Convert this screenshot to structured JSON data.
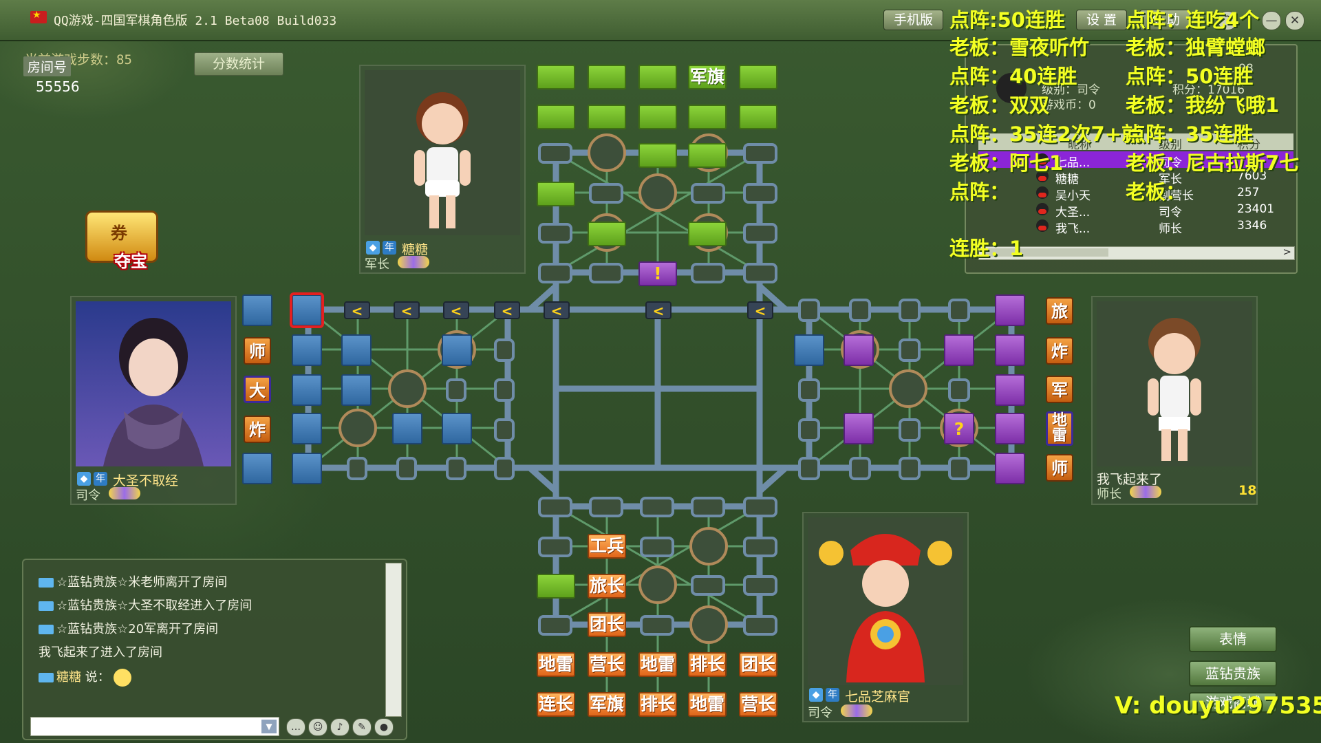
{
  "window": {
    "title": "QQ游戏-四国军棋角色版 2.1 Beta08 Build033",
    "top_buttons": [
      "手机版",
      "设 置",
      "帮 助"
    ],
    "controls": [
      "?",
      "—",
      "✕"
    ]
  },
  "room": {
    "label": "房间号",
    "number": "55556",
    "step_label": "当前游戏步数：85",
    "stats_button": "分数统计"
  },
  "treasure": {
    "label": "夺宝"
  },
  "players": {
    "top": {
      "name": "糖糖",
      "rank": "军长"
    },
    "left": {
      "name": "大圣不取经",
      "rank": "司令"
    },
    "right": {
      "name": "我飞起来了",
      "rank": "师长",
      "timer": "18"
    },
    "bottom": {
      "name": "七品芝麻官",
      "rank": "司令"
    }
  },
  "overlay": {
    "lines": [
      "点阵:50连胜",
      "点阵：连吃4个",
      "老板：雪夜听竹",
      "老板：独臂螳螂",
      "点阵：40连胜",
      "点阵：50连胜",
      "老板：双双",
      "老板：我纷飞哦1",
      "点阵：35连2次7+就",
      "点阵：35连胜",
      "老板：阿七1",
      "老板：尼古拉斯7七",
      "点阵：",
      "老板：",
      "连胜：1"
    ]
  },
  "user_panel": {
    "info": [
      "级别：司令",
      "积分：17016",
      "游戏币：0"
    ],
    "info_id": "...98",
    "headers": [
      "昵称",
      "级别",
      "积分"
    ],
    "rows": [
      {
        "name": "七品...",
        "level": "司令",
        "score": ""
      },
      {
        "name": "糖糖",
        "level": "军长",
        "score": "7603"
      },
      {
        "name": "吴小天",
        "level": "副营长",
        "score": "257"
      },
      {
        "name": "大圣...",
        "level": "司令",
        "score": "23401"
      },
      {
        "name": "我飞...",
        "level": "师长",
        "score": "3346"
      }
    ]
  },
  "board": {
    "top_flag": "军旗",
    "alert_mark": "!",
    "question_mark": "?",
    "left_labels": [
      "师",
      "大",
      "炸"
    ],
    "right_labels": [
      "旅",
      "炸",
      "军",
      "地雷",
      "师"
    ],
    "bottom_pieces": {
      "row3": [
        "工兵"
      ],
      "row4": [
        "旅长"
      ],
      "row5": [
        "团长"
      ],
      "row6": [
        "地雷",
        "营长",
        "地雷",
        "排长",
        "团长"
      ],
      "row7": [
        "连长",
        "军旗",
        "排长",
        "地雷",
        "营长"
      ]
    },
    "arrow_glyph": "<"
  },
  "chat": {
    "messages": [
      {
        "text": "☆蓝钻贵族☆米老师离开了房间",
        "diamond": true
      },
      {
        "text": "☆蓝钻贵族☆大圣不取经进入了房间",
        "diamond": true
      },
      {
        "text": "☆蓝钻贵族☆20军离开了房间",
        "diamond": true
      },
      {
        "text": "我飞起来了进入了房间",
        "diamond": false
      }
    ],
    "last_nick": "糖糖",
    "last_says": "说："
  },
  "side_buttons": [
    "表情",
    "蓝钻贵族",
    "游戏商城"
  ],
  "watermark": "V: douyu297535",
  "colors": {
    "green_piece": "#6eb826",
    "blue_piece": "#3e79b5",
    "purple_piece": "#9438c2",
    "orange_piece": "#e8782a",
    "overlay_yellow": "#f3ff23"
  }
}
